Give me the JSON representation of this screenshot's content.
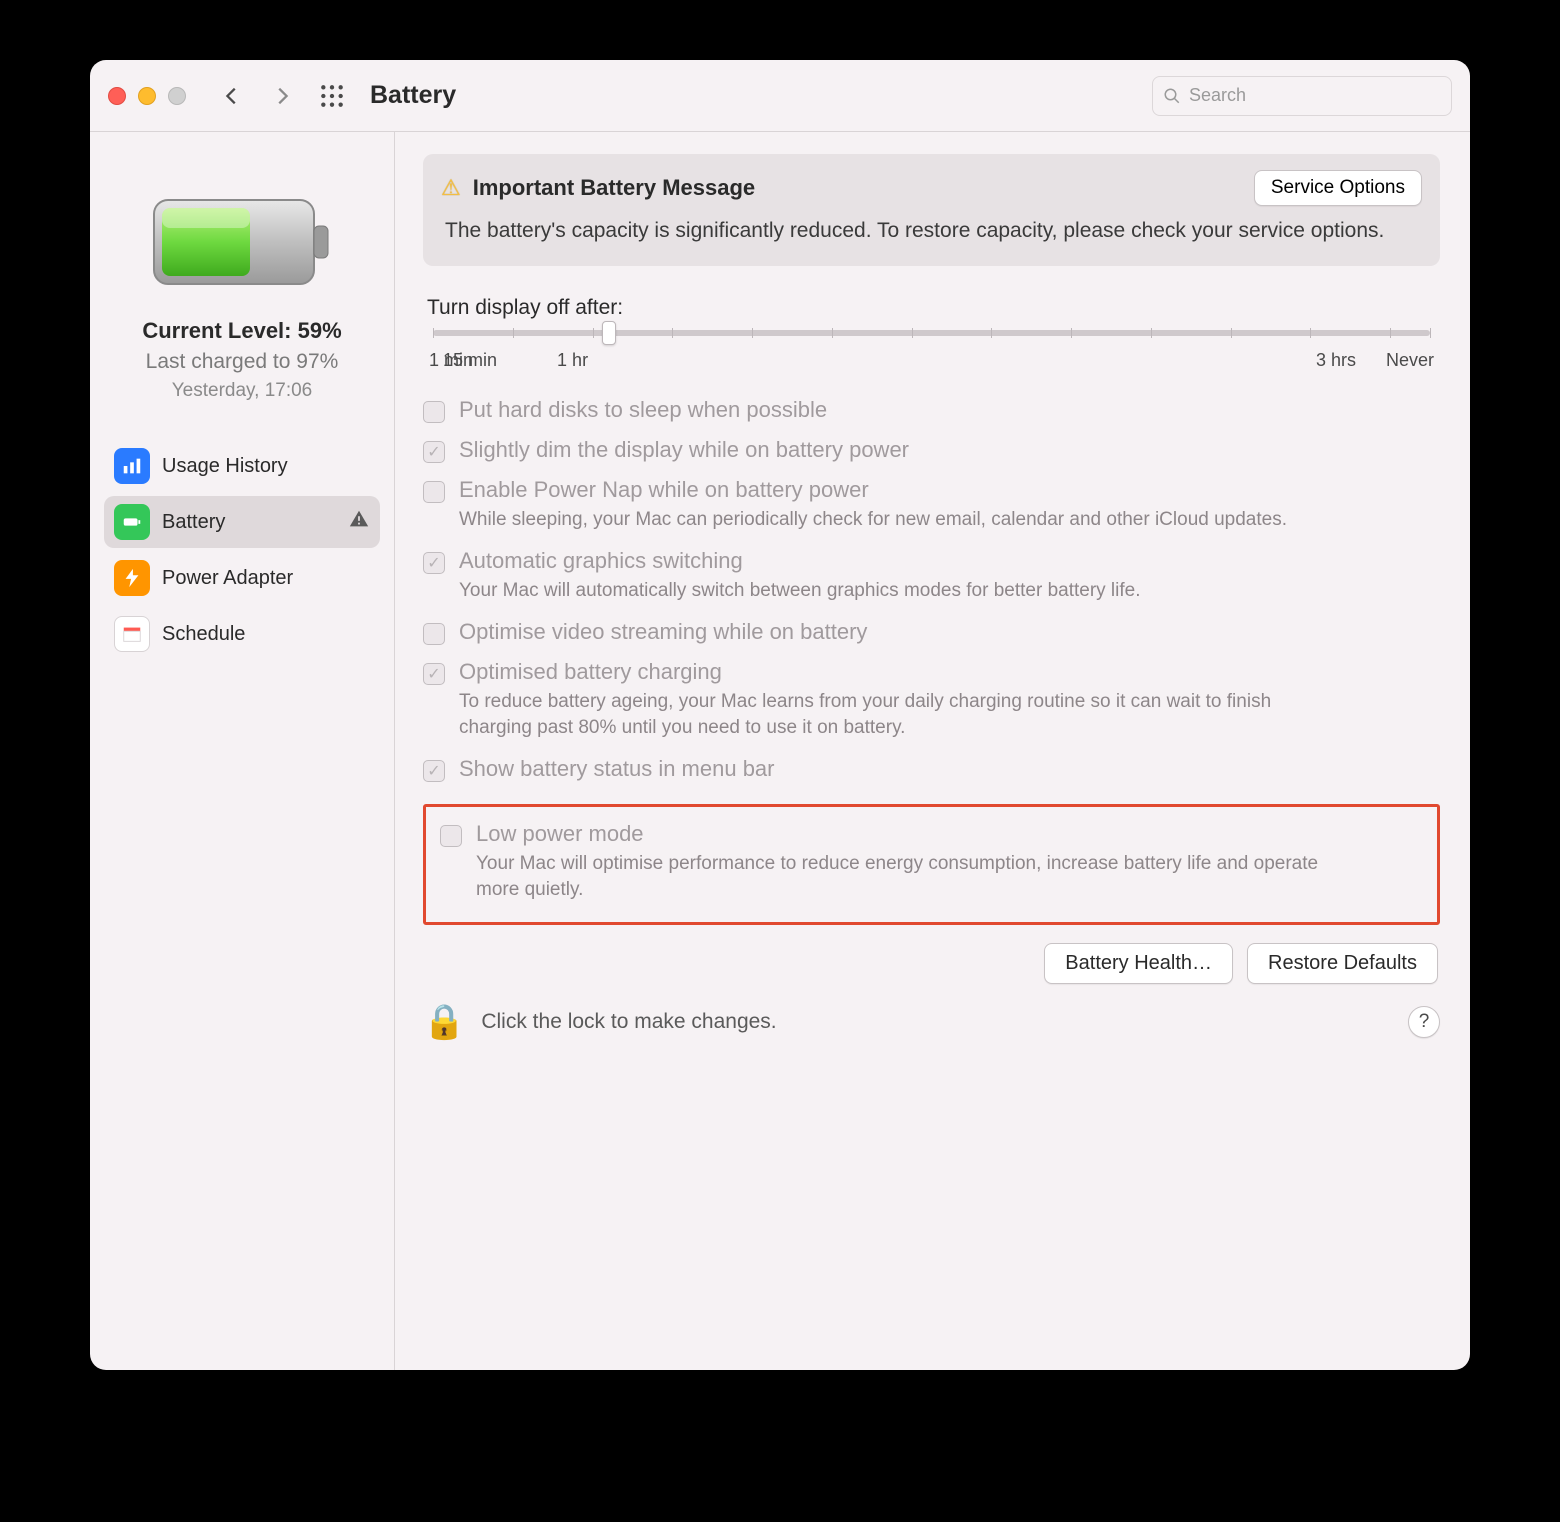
{
  "toolbar": {
    "title": "Battery",
    "search_placeholder": "Search"
  },
  "sidebar": {
    "current_level_label": "Current Level: 59%",
    "last_charged": "Last charged to 97%",
    "timestamp": "Yesterday, 17:06",
    "items": [
      {
        "label": "Usage History"
      },
      {
        "label": "Battery"
      },
      {
        "label": "Power Adapter"
      },
      {
        "label": "Schedule"
      }
    ]
  },
  "alert": {
    "title": "Important Battery Message",
    "button": "Service Options",
    "body": "The battery's capacity is significantly reduced. To restore capacity, please check your service options."
  },
  "slider": {
    "label": "Turn display off after:",
    "ticks": [
      "1 min",
      "15 min",
      "1 hr",
      "3 hrs",
      "Never"
    ]
  },
  "options": [
    {
      "checked": false,
      "label": "Put hard disks to sleep when possible",
      "desc": ""
    },
    {
      "checked": true,
      "label": "Slightly dim the display while on battery power",
      "desc": ""
    },
    {
      "checked": false,
      "label": "Enable Power Nap while on battery power",
      "desc": "While sleeping, your Mac can periodically check for new email, calendar and other iCloud updates."
    },
    {
      "checked": true,
      "label": "Automatic graphics switching",
      "desc": "Your Mac will automatically switch between graphics modes for better battery life."
    },
    {
      "checked": false,
      "label": "Optimise video streaming while on battery",
      "desc": ""
    },
    {
      "checked": true,
      "label": "Optimised battery charging",
      "desc": "To reduce battery ageing, your Mac learns from your daily charging routine so it can wait to finish charging past 80% until you need to use it on battery."
    },
    {
      "checked": true,
      "label": "Show battery status in menu bar",
      "desc": ""
    }
  ],
  "highlighted_option": {
    "checked": false,
    "label": "Low power mode",
    "desc": "Your Mac will optimise performance to reduce energy consumption, increase battery life and operate more quietly."
  },
  "footer": {
    "battery_health": "Battery Health…",
    "restore_defaults": "Restore Defaults",
    "lock_text": "Click the lock to make changes.",
    "help": "?"
  }
}
